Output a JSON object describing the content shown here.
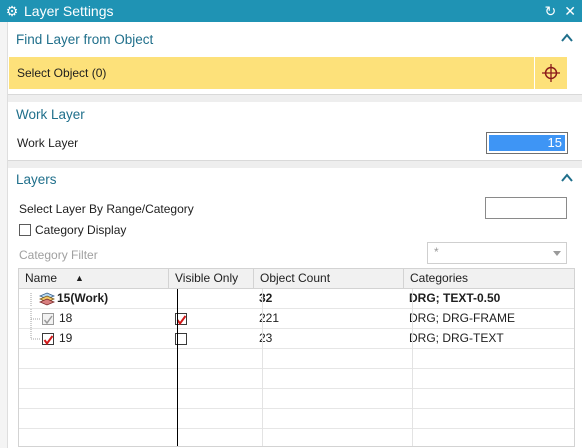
{
  "window": {
    "title": "Layer Settings",
    "title_bar_color": "#1f93b4",
    "icons": [
      "gear-icon",
      "reset-icon",
      "close-icon"
    ]
  },
  "find_layer": {
    "heading": "Find Layer from Object",
    "select_label": "Select Object (0)",
    "highlight_color": "#fde17a"
  },
  "work_layer": {
    "heading": "Work Layer",
    "label": "Work Layer",
    "value": "15"
  },
  "layers": {
    "heading": "Layers",
    "select_by_label": "Select Layer By Range/Category",
    "range_value": "",
    "category_display_label": "Category Display",
    "category_display_checked": false,
    "category_filter_label": "Category Filter",
    "category_filter_value": "*",
    "table": {
      "columns": [
        "Name",
        "Visible Only",
        "Object Count",
        "Categories"
      ],
      "sort_column": "Name",
      "rows": [
        {
          "name": "15(Work)",
          "visible_only": "",
          "count": "32",
          "categories": "DRG; TEXT-0.50",
          "work": true
        },
        {
          "name": "18",
          "visible_only": true,
          "count": "221",
          "categories": "DRG; DRG-FRAME",
          "work": false
        },
        {
          "name": "19",
          "visible_only": false,
          "count": "23",
          "categories": "DRG; DRG-TEXT",
          "work": false
        }
      ]
    }
  }
}
